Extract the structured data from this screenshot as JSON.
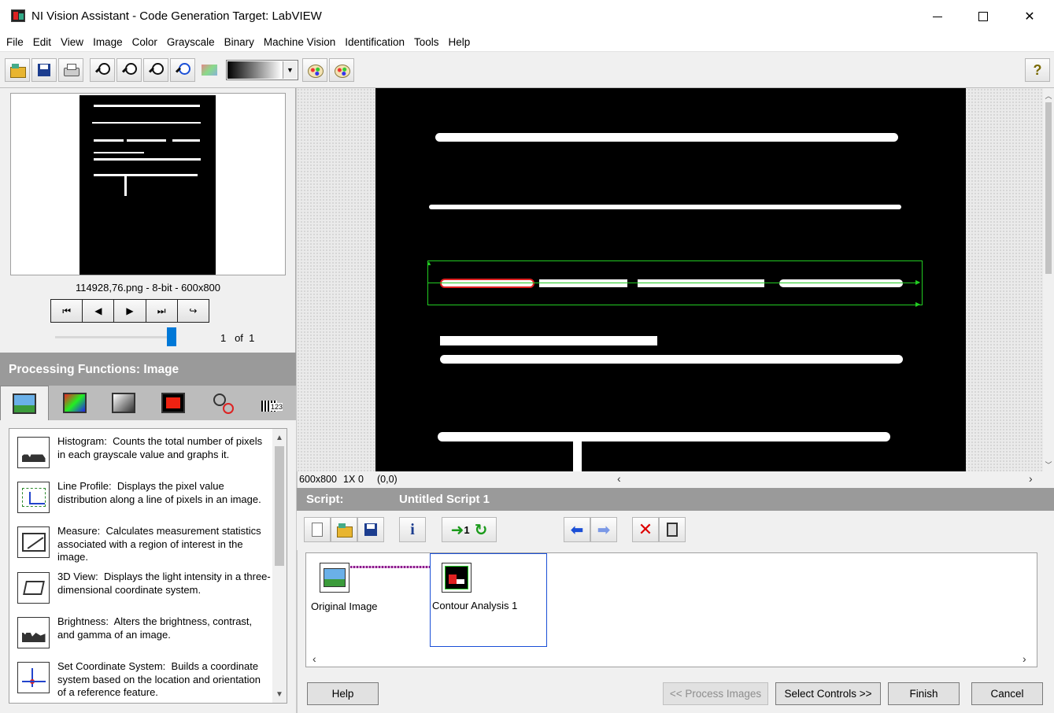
{
  "window": {
    "title": "NI Vision Assistant - Code Generation Target: LabVIEW"
  },
  "menu": [
    "File",
    "Edit",
    "View",
    "Image",
    "Color",
    "Grayscale",
    "Binary",
    "Machine Vision",
    "Identification",
    "Tools",
    "Help"
  ],
  "toolbar": {
    "icons": [
      "open-image-icon",
      "save-image-icon",
      "print-icon",
      "zoom-in-icon",
      "zoom-out-icon",
      "zoom-1to1-icon",
      "zoom-fit-icon",
      "lookup-table-icon",
      "palette-icon",
      "palette-edit-icon",
      "help-icon"
    ],
    "help_label": "?"
  },
  "thumbnail": {
    "caption": "114928,76.png - 8-bit - 600x800",
    "page_current": "1",
    "page_of": "of",
    "page_total": "1",
    "nav": [
      "first-image-icon",
      "previous-image-icon",
      "next-image-icon",
      "last-image-icon",
      "loop-icon"
    ],
    "nav_glyphs": [
      "⏮",
      "◀",
      "▶",
      "⏭",
      "↪"
    ]
  },
  "processing": {
    "header": "Processing Functions: Image",
    "tabs": [
      "Image",
      "Color",
      "Grayscale",
      "Binary",
      "Machine Vision",
      "Identification"
    ],
    "active_tab": "Image",
    "items": [
      {
        "name": "Histogram:",
        "desc": "Counts the total number of pixels in each grayscale value and graphs it."
      },
      {
        "name": "Line Profile:",
        "desc": "Displays the pixel value distribution along a line of pixels in an image."
      },
      {
        "name": "Measure:",
        "desc": "Calculates measurement statistics associated with a region of interest in the image."
      },
      {
        "name": "3D View:",
        "desc": "Displays the light intensity in a three-dimensional coordinate system."
      },
      {
        "name": "Brightness:",
        "desc": "Alters the brightness, contrast, and gamma of an image."
      },
      {
        "name": "Set Coordinate System:",
        "desc": "Builds a coordinate system based on the location and orientation of a reference feature."
      }
    ]
  },
  "image_view": {
    "status_size": "600x800",
    "status_zoom": "1X",
    "status_value": "0",
    "status_coords": "(0,0)"
  },
  "script": {
    "label": "Script:",
    "name": "Untitled Script 1",
    "run_once_label": "1",
    "steps": [
      {
        "label": "Original Image"
      },
      {
        "label": "Contour Analysis 1"
      }
    ]
  },
  "buttons": {
    "help": "Help",
    "process_images": "<< Process Images",
    "select_controls": "Select Controls >>",
    "finish": "Finish",
    "cancel": "Cancel"
  },
  "colors": {
    "header_bg": "#9a9a9a",
    "roi": "#22cc22",
    "contour": "#e02020",
    "selection": "#1a4fd6"
  }
}
